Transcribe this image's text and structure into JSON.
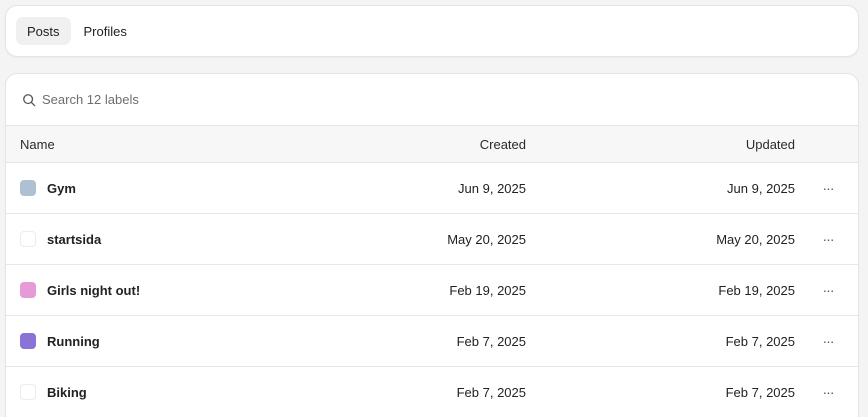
{
  "tabs": [
    {
      "label": "Posts",
      "active": true
    },
    {
      "label": "Profiles",
      "active": false
    }
  ],
  "search": {
    "placeholder": "Search 12 labels",
    "value": ""
  },
  "table": {
    "headers": {
      "name": "Name",
      "created": "Created",
      "updated": "Updated"
    },
    "rows": [
      {
        "name": "Gym",
        "color": "#aec0d2",
        "created": "Jun 9, 2025",
        "updated": "Jun 9, 2025",
        "actions": "···"
      },
      {
        "name": "startsida",
        "color": "#ffffff",
        "created": "May 20, 2025",
        "updated": "May 20, 2025",
        "actions": "···"
      },
      {
        "name": "Girls night out!",
        "color": "#e79bd6",
        "created": "Feb 19, 2025",
        "updated": "Feb 19, 2025",
        "actions": "···"
      },
      {
        "name": "Running",
        "color": "#8a72d6",
        "created": "Feb 7, 2025",
        "updated": "Feb 7, 2025",
        "actions": "···"
      },
      {
        "name": "Biking",
        "color": "#ffffff",
        "created": "Feb 7, 2025",
        "updated": "Feb 7, 2025",
        "actions": "···"
      }
    ]
  }
}
